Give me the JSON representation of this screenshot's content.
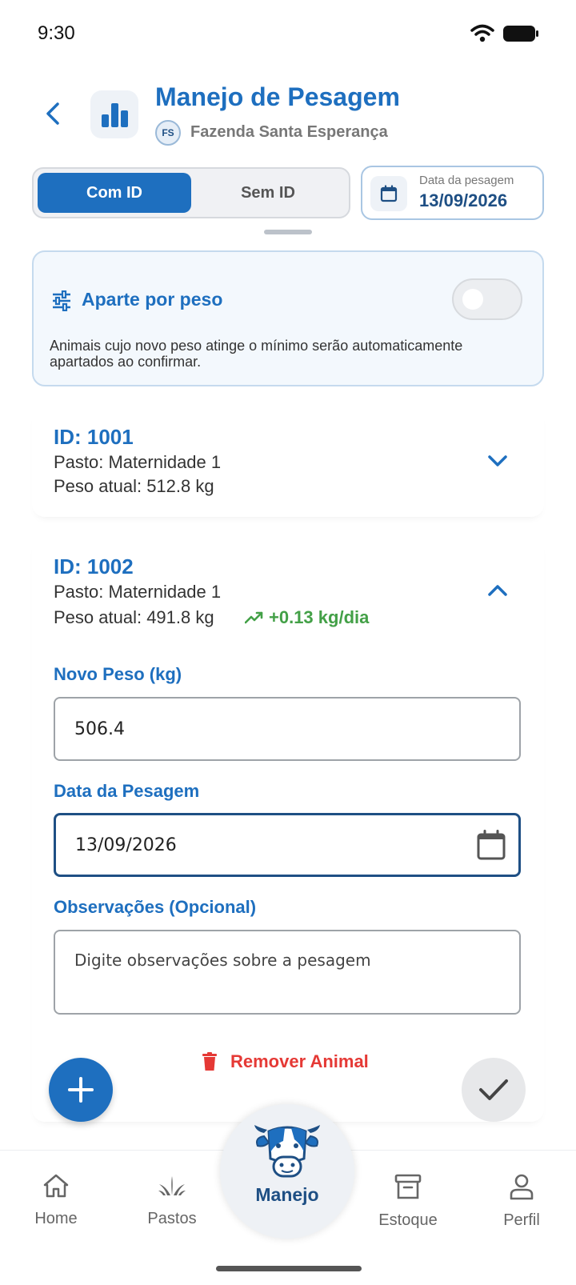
{
  "status_bar": {
    "time": "9:30"
  },
  "header": {
    "title": "Manejo de Pesagem",
    "farm_initials": "FS",
    "farm_name": "Fazenda Santa Esperança"
  },
  "mode_toggle": {
    "active": "Com ID",
    "inactive": "Sem ID"
  },
  "date_picker": {
    "label": "Data da pesagem",
    "value": "13/09/2026"
  },
  "aparte": {
    "title": "Aparte por peso",
    "enabled": false,
    "description": "Animais cujo novo peso atinge o mínimo serão automaticamente apartados ao confirmar."
  },
  "animals": [
    {
      "id_label": "ID: 1001",
      "pasture": "Pasto: Maternidade 1",
      "weight": "Peso atual: 512.8 kg",
      "expanded": false
    },
    {
      "id_label": "ID: 1002",
      "pasture": "Pasto: Maternidade 1",
      "weight": "Peso atual: 491.8 kg",
      "growth": "+0.13 kg/dia",
      "expanded": true,
      "form": {
        "new_weight_label": "Novo Peso (kg)",
        "new_weight_value": "506.4",
        "date_label": "Data da Pesagem",
        "date_value": "13/09/2026",
        "notes_label": "Observações (Opcional)",
        "notes_placeholder": "Digite observações sobre a pesagem",
        "remove_label": "Remover Animal"
      }
    }
  ],
  "bottom_nav": {
    "home": "Home",
    "pastos": "Pastos",
    "manejo": "Manejo",
    "estoque": "Estoque",
    "perfil": "Perfil"
  },
  "colors": {
    "primary": "#1e6fbf",
    "dark_primary": "#1e4f84",
    "success": "#43a047",
    "danger": "#e53935"
  }
}
